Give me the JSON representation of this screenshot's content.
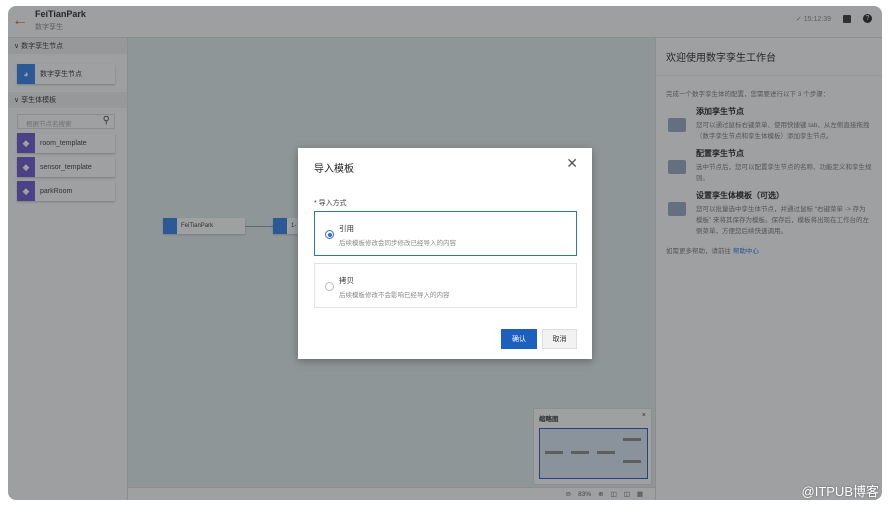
{
  "header": {
    "title": "FeiTianPark",
    "subtitle": "数字孪生",
    "time": "15:12:39"
  },
  "sidebar": {
    "section1": "数字孪生节点",
    "node_item": "数字孪生节点",
    "section2": "孪生体模板",
    "search_placeholder": "根据节点名搜索",
    "templates": [
      "room_template",
      "sensor_template",
      "parkRoom"
    ]
  },
  "canvas": {
    "nodes": [
      "FeiTianPark",
      "1-"
    ],
    "zoom": "83%",
    "minimap_title": "缩略图"
  },
  "right_panel": {
    "title": "欢迎使用数字孪生工作台",
    "intro": "完成一个数字孪生体的配置，您需要进行以下 3 个步骤：",
    "steps": [
      {
        "title": "添加孪生节点",
        "desc": "您可以通过鼠标右键菜单、使用快捷键 tab、从左侧直接拖拽（数字孪生节点和孪生体模板）添加孪生节点。"
      },
      {
        "title": "配置孪生节点",
        "desc": "选中节点后，您可以配置孪生节点的名称、功能定义和孪生规则。"
      },
      {
        "title": "设置孪生体模板（可选）",
        "desc": "您可以批量选中孪生体节点，并通过鼠标 “右键菜单 -> 存为模板” 来将其保存为模板。保存后，模板将出现在工作台的左侧菜单，方便您后续快速调用。"
      }
    ],
    "help_prefix": "如需更多帮助，请前往",
    "help_link": "帮助中心"
  },
  "modal": {
    "title": "导入模板",
    "field_label": "* 导入方式",
    "options": [
      {
        "name": "引用",
        "desc": "后续模板修改会同步修改已经导入的内容",
        "selected": true
      },
      {
        "name": "拷贝",
        "desc": "后续模板修改不会影响已经导入的内容",
        "selected": false
      }
    ],
    "confirm": "确认",
    "cancel": "取消"
  },
  "watermark": "@ITPUB博客"
}
